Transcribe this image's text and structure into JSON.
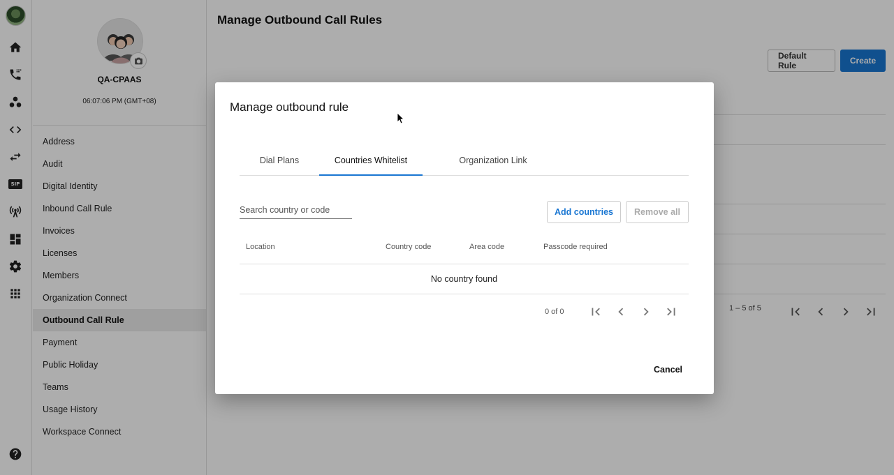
{
  "rail": {
    "icons": [
      "home-icon",
      "phone-icon",
      "groups-icon",
      "code-icon",
      "swap-icon",
      "sip-icon",
      "antenna-icon",
      "dashboard-icon",
      "gear-icon",
      "apps-icon",
      "help-icon"
    ],
    "sip_label": "SIP"
  },
  "profile": {
    "org_name": "QA-CPAAS",
    "time": "06:07:06 PM (GMT+08)"
  },
  "menu": {
    "items": [
      {
        "label": "Address"
      },
      {
        "label": "Audit"
      },
      {
        "label": "Digital Identity"
      },
      {
        "label": "Inbound Call Rule"
      },
      {
        "label": "Invoices"
      },
      {
        "label": "Licenses"
      },
      {
        "label": "Members"
      },
      {
        "label": "Organization Connect"
      },
      {
        "label": "Outbound Call Rule"
      },
      {
        "label": "Payment"
      },
      {
        "label": "Public Holiday"
      },
      {
        "label": "Teams"
      },
      {
        "label": "Usage History"
      },
      {
        "label": "Workspace Connect"
      }
    ],
    "active": "Outbound Call Rule"
  },
  "main": {
    "title": "Manage Outbound Call Rules",
    "default_rule_label": "Default Rule",
    "create_label": "Create",
    "pager_text": "1 – 5 of 5"
  },
  "dialog": {
    "title": "Manage outbound rule",
    "tabs": [
      {
        "label": "Dial Plans"
      },
      {
        "label": "Countries Whitelist"
      },
      {
        "label": "Organization Link"
      }
    ],
    "active_tab": "Countries Whitelist",
    "search_placeholder": "Search country or code",
    "add_label": "Add countries",
    "remove_label": "Remove all",
    "columns": [
      "Location",
      "Country code",
      "Area code",
      "Passcode required"
    ],
    "empty_text": "No country found",
    "pager_text": "0 of 0",
    "cancel_label": "Cancel"
  },
  "colors": {
    "accent": "#1976d2",
    "active_menu_bg": "#ebebeb"
  }
}
